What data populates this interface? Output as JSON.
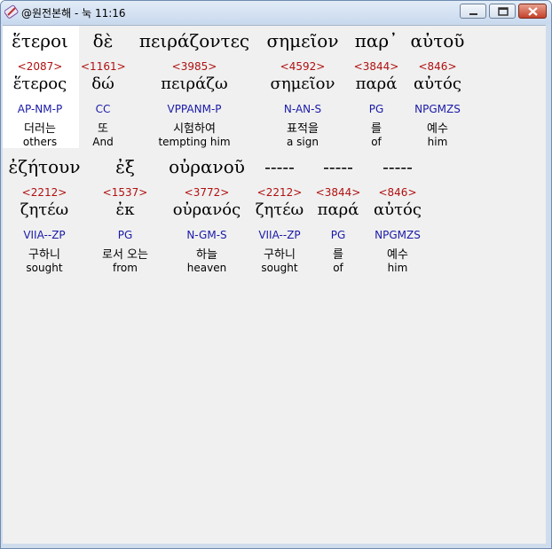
{
  "window": {
    "title": "@원전본해 - 눅 11:16"
  },
  "verse_rows": [
    {
      "words": [
        {
          "greek": "ἕτεροι",
          "strongs": "<2087>",
          "lemma": "ἕτερος",
          "parsing": "AP-NM-P",
          "korean": "더러는",
          "english": "others"
        },
        {
          "greek": "δὲ",
          "strongs": "<1161>",
          "lemma": "δώ",
          "parsing": "CC",
          "korean": "또",
          "english": "And"
        },
        {
          "greek": "πειράζοντες",
          "strongs": "<3985>",
          "lemma": "πειράζω",
          "parsing": "VPPANM-P",
          "korean": "시험하여",
          "english": "tempting him"
        },
        {
          "greek": "σημεῖον",
          "strongs": "<4592>",
          "lemma": "σημεῖον",
          "parsing": "N-AN-S",
          "korean": "표적을",
          "english": "a sign"
        },
        {
          "greek": "παρ᾽",
          "strongs": "<3844>",
          "lemma": "παρά",
          "parsing": "PG",
          "korean": "를",
          "english": "of"
        },
        {
          "greek": "αὐτοῦ",
          "strongs": "<846>",
          "lemma": "αὐτός",
          "parsing": "NPGMZS",
          "korean": "예수",
          "english": "him"
        }
      ]
    },
    {
      "words": [
        {
          "greek": "ἐζήτουν",
          "strongs": "<2212>",
          "lemma": "ζητέω",
          "parsing": "VIIA--ZP",
          "korean": "구하니",
          "english": "sought"
        },
        {
          "greek": "ἐξ",
          "strongs": "<1537>",
          "lemma": "ἐκ",
          "parsing": "PG",
          "korean": "로서 오는",
          "english": "from"
        },
        {
          "greek": "οὐρανοῦ",
          "strongs": "<3772>",
          "lemma": "οὐρανός",
          "parsing": "N-GM-S",
          "korean": "하늘",
          "english": "heaven"
        },
        {
          "greek": "-----",
          "strongs": "<2212>",
          "lemma": "ζητέω",
          "parsing": "VIIA--ZP",
          "korean": "구하니",
          "english": "sought"
        },
        {
          "greek": "-----",
          "strongs": "<3844>",
          "lemma": "παρά",
          "parsing": "PG",
          "korean": "를",
          "english": "of"
        },
        {
          "greek": "-----",
          "strongs": "<846>",
          "lemma": "αὐτός",
          "parsing": "NPGMZS",
          "korean": "예수",
          "english": "him"
        }
      ]
    }
  ]
}
